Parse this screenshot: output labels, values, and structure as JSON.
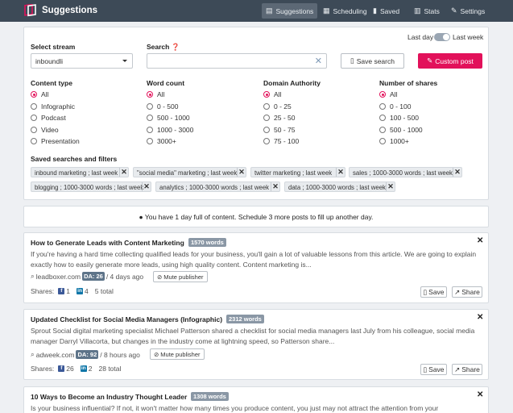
{
  "app": {
    "title": "Suggestions"
  },
  "nav": [
    {
      "label": "Suggestions",
      "icon": "document-icon"
    },
    {
      "label": "Scheduling",
      "icon": "calendar-icon"
    },
    {
      "label": "Saved",
      "icon": "bookmark-icon"
    },
    {
      "label": "Stats",
      "icon": "bar-chart-icon"
    },
    {
      "label": "Settings",
      "icon": "wrench-icon"
    }
  ],
  "filters": {
    "toggle_left": "Last day",
    "toggle_right": "Last week",
    "stream_label": "Select stream",
    "stream_value": "inboundli",
    "search_label": "Search",
    "search_value": "",
    "save_search": "Save search",
    "custom_post": "Custom post",
    "content_type": {
      "label": "Content type",
      "options": [
        "All",
        "Infographic",
        "Podcast",
        "Video",
        "Presentation"
      ],
      "selected": 0
    },
    "word_count": {
      "label": "Word count",
      "options": [
        "All",
        "0 - 500",
        "500 - 1000",
        "1000 - 3000",
        "3000+"
      ],
      "selected": 0
    },
    "domain_authority": {
      "label": "Domain Authority",
      "options": [
        "All",
        "0 - 25",
        "25 - 50",
        "50 - 75",
        "75 - 100"
      ],
      "selected": 0
    },
    "shares": {
      "label": "Number of shares",
      "options": [
        "All",
        "0 - 100",
        "100 - 500",
        "500 - 1000",
        "1000+"
      ],
      "selected": 0
    },
    "saved_label": "Saved searches and filters",
    "saved": [
      "inbound marketing ; last week",
      "\"social media\" marketing ; last week",
      "twitter marketing ; last week",
      "sales ; 1000-3000 words ; last week",
      "blogging ; 1000-3000 words ; last week",
      "analytics ; 1000-3000 words ; last week",
      "data ; 1000-3000 words ; last week"
    ]
  },
  "notice": "You have 1 day full of content. Schedule 3 more posts to fill up another day.",
  "articles": [
    {
      "title": "How to Generate Leads with Content Marketing",
      "words": "1570 words",
      "excerpt": "If you're having a hard time collecting qualified leads for your business, you'll gain a lot of valuable lessons from this article. We are going to explain exactly how to easily generate more leads, using high quality content. Content marketing is...",
      "domain": "leadboxer.com",
      "da": "DA: 26",
      "age": "/ 4 days ago",
      "mute": "Mute publisher",
      "shares_label": "Shares:",
      "fb": "1",
      "li": "4",
      "total": "5 total",
      "save": "Save",
      "share": "Share"
    },
    {
      "title": "Updated Checklist for Social Media Managers (Infographic)",
      "words": "2312 words",
      "excerpt": "Sprout Social digital marketing specialist Michael Patterson shared a checklist for social media managers last July from his colleague, social media manager Darryl Villacorta, but changes in the industry come at lightning speed, so Patterson share...",
      "domain": "adweek.com",
      "da": "DA: 92",
      "age": "/ 8 hours ago",
      "mute": "Mute publisher",
      "shares_label": "Shares:",
      "fb": "26",
      "li": "2",
      "total": "28 total",
      "save": "Save",
      "share": "Share"
    },
    {
      "title": "10 Ways to Become an Industry Thought Leader",
      "words": "1308 words",
      "excerpt": "Is your business influential? If not, it won't matter how many times you produce content, you just may not attract the attention from your"
    }
  ],
  "colors": {
    "topbar": "#3d4a57",
    "accent": "#e2115a",
    "badge": "#8a97a5",
    "da": "#5e7489"
  }
}
